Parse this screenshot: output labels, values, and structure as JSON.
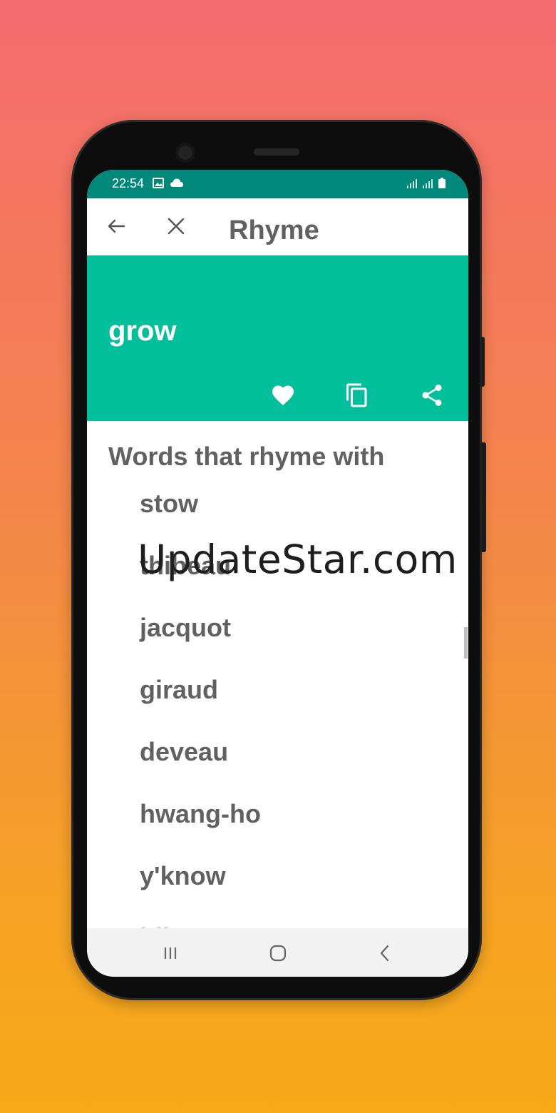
{
  "status_bar": {
    "time": "22:54"
  },
  "toolbar": {
    "title": "Rhyme"
  },
  "hero": {
    "word": "grow"
  },
  "content": {
    "heading": "Words that rhyme with",
    "rhymes": [
      "stow",
      "thibeau",
      "jacquot",
      "giraud",
      "deveau",
      "hwang-ho",
      "y'know",
      "bibeau"
    ]
  },
  "watermark": "UpdateStar.com",
  "colors": {
    "status_bar": "#00897b",
    "accent": "#00bf9a",
    "text_gray": "#616161",
    "nav_bar": "#f2f2f2"
  },
  "icons": {
    "toolbar": [
      "arrow-back-icon",
      "close-icon"
    ],
    "hero_actions": [
      "heart-icon",
      "copy-icon",
      "share-icon"
    ],
    "navigation": [
      "recents-icon",
      "home-icon",
      "back-nav-icon"
    ]
  }
}
